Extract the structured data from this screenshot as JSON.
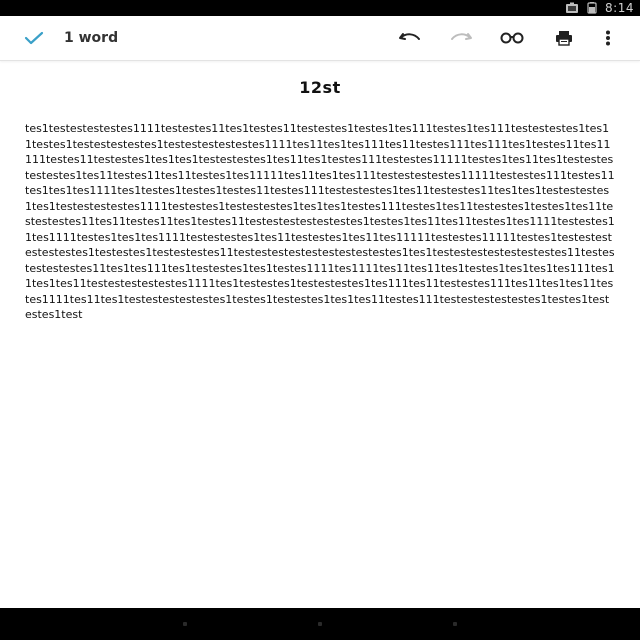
{
  "status_bar": {
    "time": "8:14",
    "icons": [
      "screenshot-icon",
      "battery-icon"
    ]
  },
  "toolbar": {
    "word_count": "1 word",
    "icons": {
      "done": "checkmark-icon",
      "undo": "undo-icon",
      "redo": "redo-icon",
      "preview": "glasses-icon",
      "print": "print-icon",
      "menu": "more-vert-icon"
    }
  },
  "document": {
    "title": "12st",
    "body": "tes1testestestestes1111testestes11tes1testes11testestes1testes1tes111testes1tes111testestestes1tes11testes1testestestestes1testestestestestes1111tes11tes1tes111tes11testes111tes111tes1testes11tes11111testes11testestes1tes1tes1testestestes1tes11tes1testes111testestes11111testes1tes11tes1testestestestestes1tes11testes11tes11testes1tes11111tes11tes1tes111testestestestes11111testestes111testes11tes1tes1tes1111tes1testes1testes1testes11testes111testestestes1tes11testestes11tes1tes1testestestes1tes1testestestestes1111testestes1testestestes1tes1tes1testes111testes1tes11testestes1testes1tes11testestestes11tes11testes11tes1testes11testestestestestestes1testes1tes11tes11testes1tes1111testestes11tes1111testes1tes1tes1111testestestes1tes11testestes1tes11tes11111testestes11111testes1testestestestestestes1testestes1testestestes11testestestestestestestestestes1tes1testestestestestestestes11testestestestestes11tes1tes111tes1testestes1tes1testes1111tes1111tes11tes11tes1testes1tes1tes1tes111tes11tes1tes11testestestestestes1111tes1testestes1testestestes1tes111tes11testestes111tes11tes1tes11testes1111tes11tes1testestestestestes1testes1testestes1tes1tes11testes111testestestestestes1testes1testestes1test"
  },
  "nav_bar": {
    "icons": [
      "back-icon",
      "home-icon",
      "recents-icon"
    ]
  },
  "colors": {
    "accent": "#3aa0c8",
    "text": "#111111",
    "icon": "#222222",
    "icon_disabled": "#bdbdbd",
    "status_bar": "#000000"
  }
}
